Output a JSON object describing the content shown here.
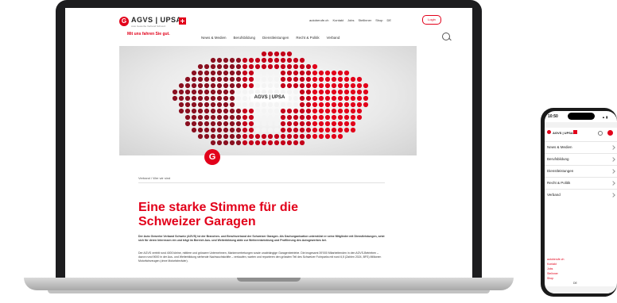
{
  "brand": {
    "logo_text": "AGVS | UPSA",
    "logo_sub": "Auto Gewerbe Verband Schweiz",
    "tagline": "Mit uns fahren Sie gut."
  },
  "utility_nav": [
    "autoberufe.ch",
    "Kontakt",
    "Jobs",
    "Stellinner",
    "Shop",
    "DE"
  ],
  "login_label": "Login",
  "main_nav": [
    "News & Medien",
    "Berufsbildung",
    "Dienstleistungen",
    "Recht & Politik",
    "Verband"
  ],
  "hero": {
    "map_logo": "AGVS | UPSA"
  },
  "breadcrumb": "Verband / Wer wir sind",
  "headline": "Eine starke Stimme für die Schweizer Garagen",
  "paragraph_1": "Der Auto Gewerbe Verband Schweiz (AGVS) ist der Branchen- und Berufsverband der Schweizer Garagen. Als Dachorganisation unterstützt er seine Mitglieder mit Dienstleistungen, setzt sich für deren Interessen ein und trägt im Bereich Aus- und Weiterbildung aktiv zur Weiterentwicklung und Profilierung des Autogewerbes bei.",
  "paragraph_2": "Der AGVS vertritt rund 4000 kleine, mittlere und grössere Unternehmen, Markenvertretungen sowie unabhängige Garagenbetriebe. Die insgesamt 39'000 Mitarbeitenden in den AGVS-Betrieben – davon rund 9000 in der Aus- und Weiterbildung stehende Nachwuchskräfte – verkaufen, warten und reparieren den grössten Teil des Schweizer Fuhrparks mit rund 6,5 (Zahlen 2024, BFS) Millionen Motorfahrzeugen (ohne Motorfahrräder).",
  "phone": {
    "time": "10:50",
    "signal": "▲ ▮",
    "menu_items": [
      "News & Medien",
      "Berufsbildung",
      "Dienstleistungen",
      "Recht & Politik",
      "Verband"
    ],
    "links": [
      "autoberufe.ch",
      "Kontakt",
      "Jobs",
      "Stelinner",
      "Shop"
    ],
    "language": "DE"
  },
  "colors": {
    "brand_red": "#e2001a",
    "device_frame": "#1d1d1f"
  }
}
